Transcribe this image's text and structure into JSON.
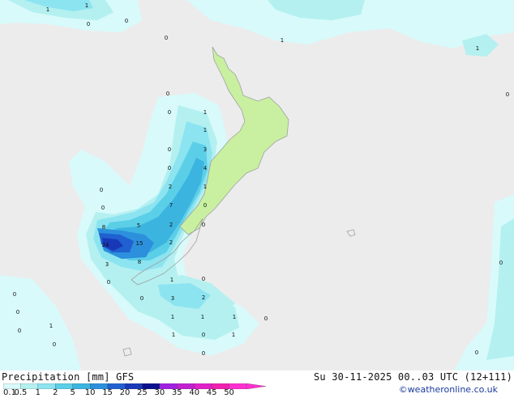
{
  "title": {
    "left": "Precipitation [mm] GFS",
    "right": "Su 30-11-2025 00..03 UTC (12+111)"
  },
  "credit": "©weatheronline.co.uk",
  "legend": {
    "labels": [
      "0.1",
      "0.5",
      "1",
      "2",
      "5",
      "10",
      "15",
      "20",
      "25",
      "30",
      "35",
      "40",
      "45",
      "50"
    ],
    "colors": [
      "#d8fafa",
      "#b4f0f0",
      "#8ce4f0",
      "#5ccfe8",
      "#3cb4e0",
      "#2c90dc",
      "#2060d0",
      "#1838b8",
      "#0a108c",
      "#a020e0",
      "#c020d0",
      "#e020c8",
      "#f020b0",
      "#ff30d0"
    ]
  },
  "map_numbers": [
    "1",
    "1",
    "0",
    "0",
    "0",
    "1",
    "0",
    "1",
    "0",
    "1",
    "0",
    "3",
    "0",
    "4",
    "0",
    "2",
    "1",
    "0",
    "7",
    "0",
    "5",
    "2",
    "0",
    "8",
    "24",
    "15",
    "2",
    "3",
    "8",
    "0",
    "1",
    "0",
    "0",
    "3",
    "2",
    "1",
    "1",
    "1",
    "1",
    "0",
    "0",
    "1",
    "0",
    "1",
    "0",
    "0",
    "0",
    "0",
    "0",
    "1",
    "0",
    "0"
  ],
  "colors": {
    "background": "#ececec",
    "land": "#c8f0a0",
    "coast": "#a0a0a0"
  }
}
